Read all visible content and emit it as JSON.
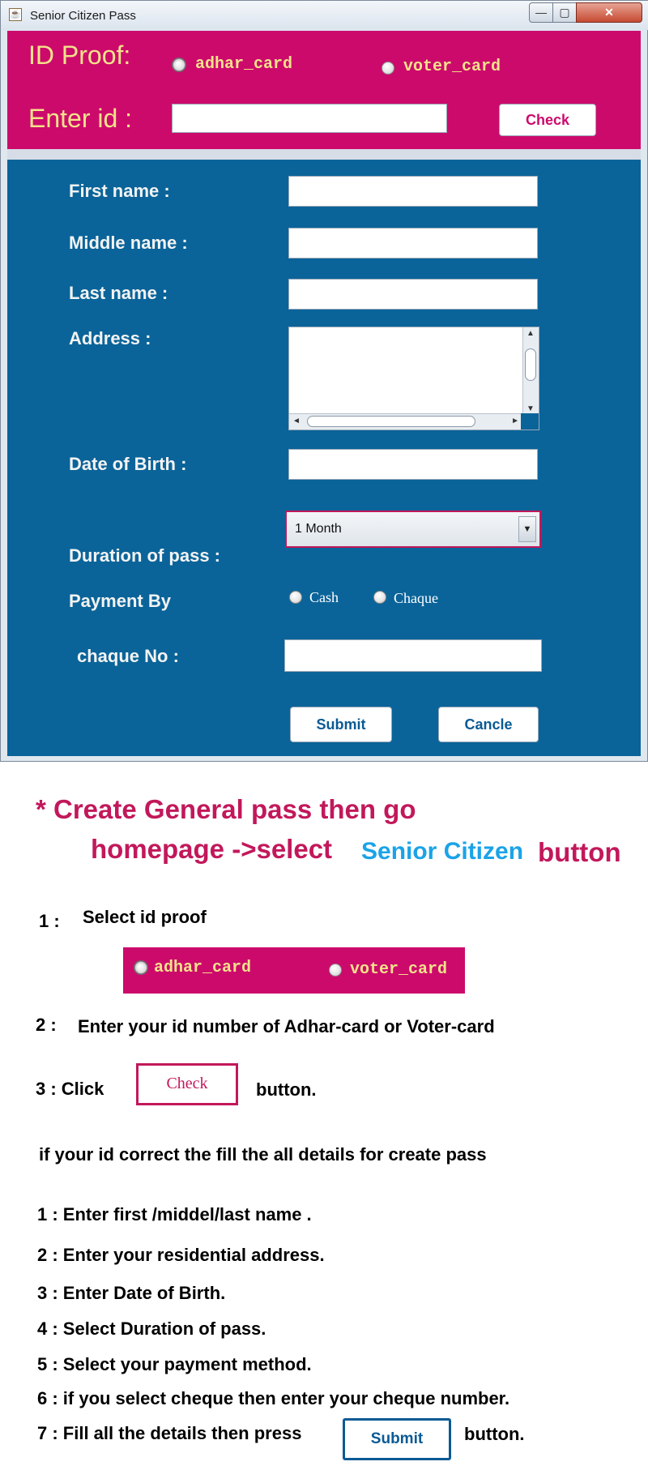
{
  "window": {
    "title": "Senior Citizen Pass",
    "controls": {
      "minimize": "—",
      "maximize": "▢",
      "close": "✕"
    }
  },
  "header": {
    "id_proof_label": "ID Proof:",
    "radio_adhar": "adhar_card",
    "radio_voter": "voter_card",
    "enter_id_label": "Enter id :",
    "id_input_value": "",
    "check_button": "Check"
  },
  "form": {
    "first_name_label": "First name :",
    "middle_name_label": "Middle name :",
    "last_name_label": "Last name :",
    "address_label": "Address :",
    "dob_label": "Date of Birth :",
    "duration_label": "Duration of pass :",
    "duration_selected": "1 Month",
    "payment_label": "Payment By",
    "pay_cash": "Cash",
    "pay_cheque": "Chaque",
    "cheque_no_label": "chaque No :",
    "submit_button": "Submit",
    "cancel_button": "Cancle"
  },
  "instructions": {
    "heading_line1": "* Create General pass then go",
    "heading_line2_a": "homepage ->select",
    "heading_line2_b": "Senior Citizen",
    "heading_line2_c": "button",
    "step1_num": "1 :",
    "step1_text": "Select id proof",
    "sample_adhar": "adhar_card",
    "sample_voter": "voter_card",
    "step2_num": "2 :",
    "step2_text": "Enter your id number of Adhar-card or Voter-card",
    "step3_prefix": "3 : Click",
    "step3_button": "Check",
    "step3_suffix": "button.",
    "if_correct": "if your id correct the fill the all details for create pass",
    "d1": "1 : Enter first /middel/last name .",
    "d2": "2 :  Enter your residential address.",
    "d3": "3 : Enter Date of Birth.",
    "d4": "4 : Select Duration of pass.",
    "d5": "5 : Select your payment method.",
    "d6": "6 : if you select cheque then enter your cheque number.",
    "d7_prefix": "7 : Fill all the details then press",
    "d7_button": "Submit",
    "d7_suffix": "button."
  },
  "colors": {
    "header_bg": "#cc0a6c",
    "form_bg": "#0a6499",
    "label_yellow": "#f3e38a",
    "heading_pink": "#c2185b",
    "heading_cyan": "#1aa3e8"
  }
}
